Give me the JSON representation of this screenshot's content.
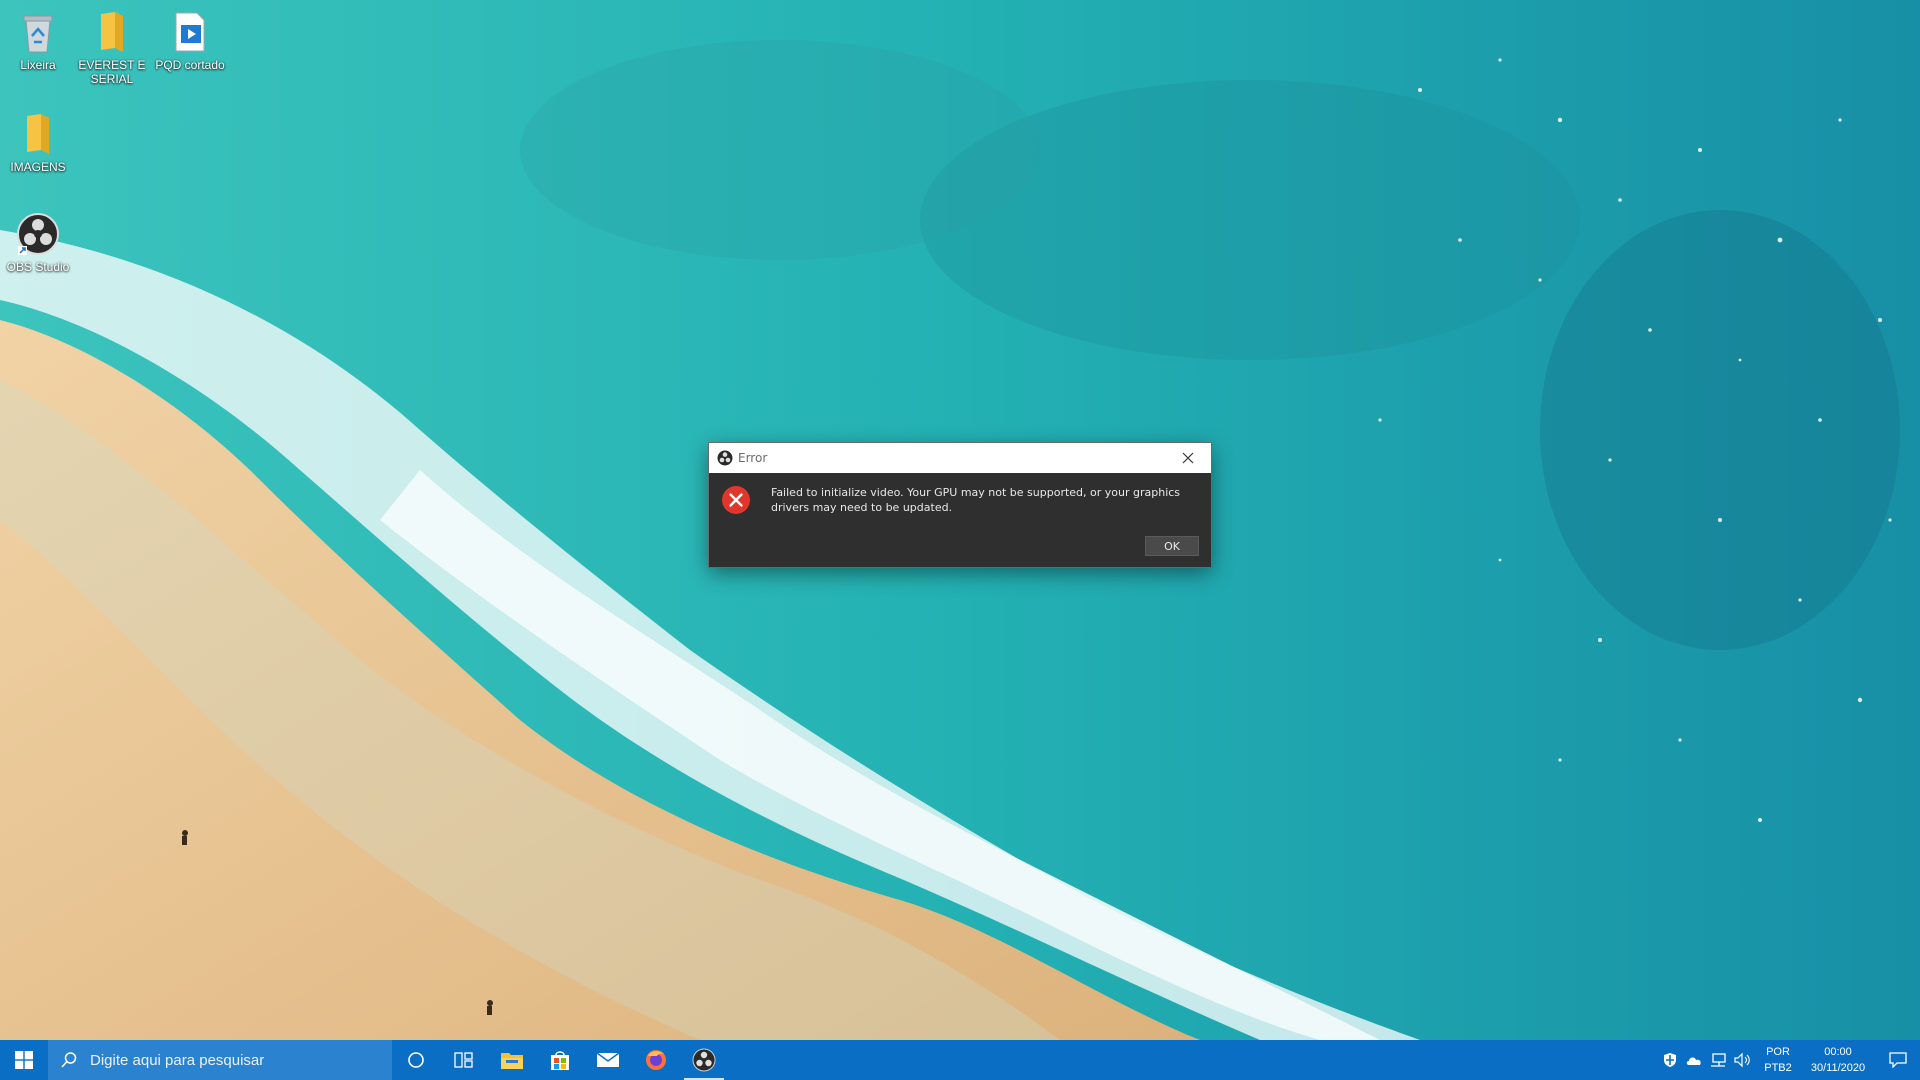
{
  "colors": {
    "taskbar": "#0a6fc4",
    "search_box": "#2b83cf",
    "dialog_body": "#2f2f2f",
    "error_red": "#e0362c",
    "sand": "#e9c795",
    "sea": "#2fb8b5"
  },
  "desktop": {
    "icons": [
      {
        "name": "recycle-bin",
        "label": "Lixeira",
        "icon": "recycle-bin-icon"
      },
      {
        "name": "everest-folder",
        "label": "EVEREST E\nSERIAL",
        "icon": "folder-icon"
      },
      {
        "name": "pqd-cortado",
        "label": "PQD cortado",
        "icon": "video-file-icon"
      },
      {
        "name": "imagens-folder",
        "label": "IMAGENS",
        "icon": "folder-icon"
      },
      {
        "name": "obs-studio",
        "label": "OBS Studio",
        "icon": "obs-icon"
      }
    ]
  },
  "dialog": {
    "title": "Error",
    "message": "Failed to initialize video.  Your GPU may not be supported, or your graphics drivers may need to be updated.",
    "ok_label": "OK",
    "icon": "error-icon"
  },
  "taskbar": {
    "search_placeholder": "Digite aqui para pesquisar",
    "apps": [
      "cortana-icon",
      "task-view-icon",
      "file-explorer-icon",
      "store-icon",
      "mail-icon",
      "firefox-icon",
      "obs-icon"
    ],
    "tray": {
      "lang_top": "POR",
      "lang_bottom": "PTB2",
      "time": "00:00",
      "date": "30/11/2020"
    }
  }
}
